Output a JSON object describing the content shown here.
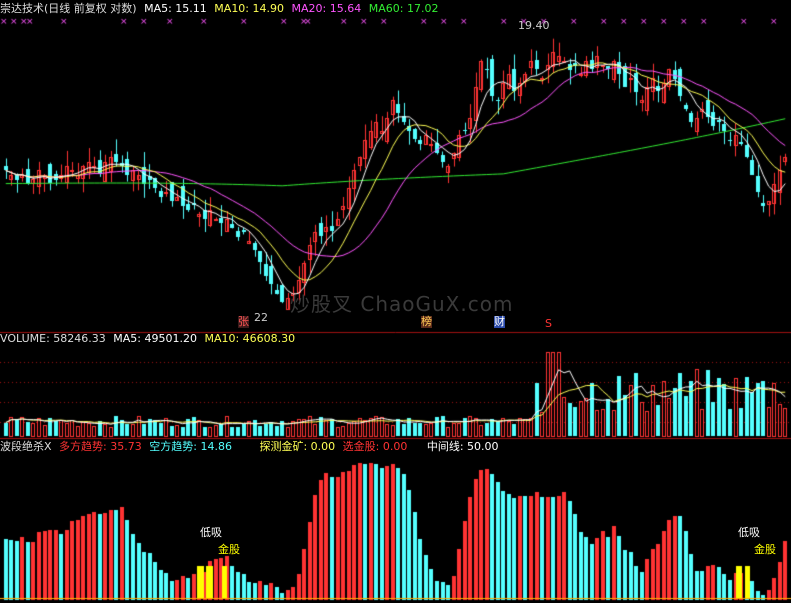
{
  "colors": {
    "bg": "#000000",
    "up": "#ff3333",
    "down": "#54ffff",
    "grid": "#a01010",
    "ma5": "#ffffff",
    "ma10": "#ffff55",
    "ma20": "#ff55ff",
    "ma60": "#33ee33",
    "gold": "#ffff00",
    "axis_divider": "#a01010"
  },
  "price_panel": {
    "title": "崇达技术(日线 前复权 对数)",
    "ma5_label": "MA5: 15.11",
    "ma10_label": "MA10: 14.90",
    "ma20_label": "MA20: 15.64",
    "ma60_label": "MA60: 17.02",
    "high_label": "19.40",
    "low_label": "22",
    "marker_zhang": "张",
    "marker_bang": "榜",
    "marker_cai": "财",
    "marker_s": "S",
    "watermark": "炒股叉 ChaoGuX.com"
  },
  "volume_panel": {
    "vol_label": "VOLUME: 58246.33",
    "ma5_label": "MA5: 49501.20",
    "ma10_label": "MA10: 46608.30"
  },
  "indicator_panel": {
    "name": "波段绝杀X",
    "bull_label": "多方趋势: 35.73",
    "bear_label": "空方趋势: 14.86",
    "probe_label": "探测金矿: 0.00",
    "select_label": "选金股: 0.00",
    "mid_label": "中间线: 50.00",
    "low_buy_1": "低吸",
    "gold_stock_1": "金股",
    "low_buy_2": "低吸",
    "gold_stock_2": "金股"
  },
  "chart_data": {
    "type": "candlestick",
    "panels": [
      "price",
      "volume",
      "indicator"
    ],
    "price_high_marked": 19.4,
    "ma5": 15.11,
    "ma10": 14.9,
    "ma20": 15.64,
    "ma60": 17.02,
    "volume": 58246.33,
    "volume_ma5": 49501.2,
    "volume_ma10": 46608.3,
    "bull_trend": 35.73,
    "bear_trend": 14.86,
    "probe_gold": 0.0,
    "select_gold": 0.0,
    "mid_line": 50.0,
    "close_series": [
      16.7,
      16.6,
      16.5,
      16.6,
      16.4,
      16.5,
      16.7,
      16.6,
      16.4,
      16.5,
      16.6,
      16.8,
      16.7,
      16.6,
      16.8,
      16.9,
      16.8,
      16.6,
      16.9,
      17.0,
      16.9,
      16.8,
      16.6,
      16.7,
      16.6,
      16.4,
      16.5,
      16.3,
      16.1,
      16.2,
      16.0,
      16.1,
      15.9,
      15.8,
      15.9,
      15.7,
      15.6,
      15.8,
      15.6,
      15.5,
      15.6,
      15.4,
      15.2,
      15.3,
      15.1,
      14.9,
      14.6,
      14.3,
      14.1,
      13.9,
      13.7,
      13.8,
      13.9,
      14.2,
      14.6,
      15.0,
      15.3,
      15.2,
      15.4,
      15.3,
      15.6,
      15.9,
      16.3,
      16.7,
      17.0,
      17.4,
      17.6,
      17.8,
      17.6,
      17.9,
      18.3,
      18.0,
      17.8,
      17.6,
      17.4,
      17.3,
      17.5,
      17.3,
      17.1,
      16.9,
      16.8,
      17.1,
      17.5,
      17.6,
      17.9,
      18.6,
      19.2,
      19.0,
      18.4,
      18.3,
      18.7,
      18.9,
      18.5,
      18.7,
      18.9,
      19.2,
      19.0,
      18.8,
      19.1,
      19.4,
      19.3,
      19.2,
      19.0,
      19.1,
      18.9,
      19.2,
      19.0,
      19.3,
      19.1,
      19.0,
      19.2,
      18.9,
      18.6,
      18.8,
      18.5,
      18.3,
      18.6,
      18.8,
      18.5,
      18.7,
      19.0,
      18.8,
      18.4,
      18.1,
      17.8,
      17.9,
      18.1,
      17.9,
      17.7,
      17.8,
      17.6,
      17.4,
      17.5,
      17.3,
      17.0,
      16.6,
      16.2,
      15.9,
      16.0,
      16.4,
      16.7,
      17.0
    ]
  }
}
